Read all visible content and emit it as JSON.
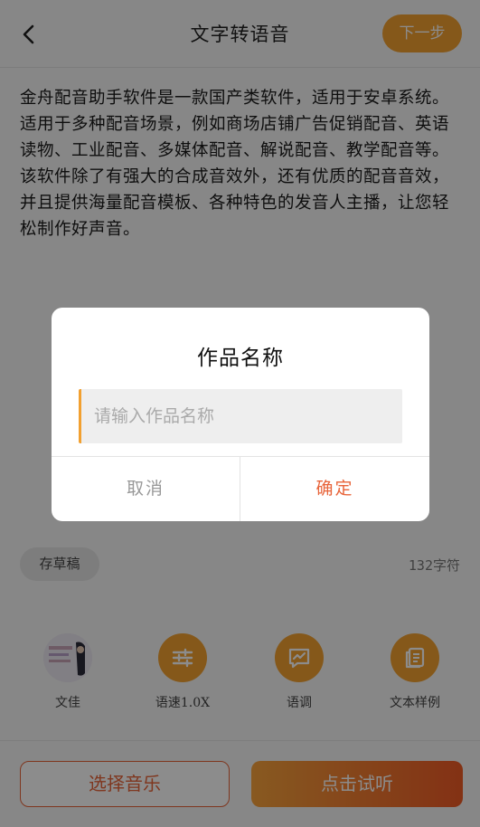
{
  "header": {
    "title": "文字转语音",
    "next_label": "下一步"
  },
  "content": {
    "text": "金舟配音助手软件是一款国产类软件，适用于安卓系统。适用于多种配音场景，例如商场店铺广告促销配音、英语读物、工业配音、多媒体配音、解说配音、教学配音等。该软件除了有强大的合成音效外，还有优质的配音音效，并且提供海量配音模板、各种特色的发音人主播，让您轻松制作好声音。"
  },
  "draft": {
    "label": "存草稿",
    "char_count": "132字符"
  },
  "tools": [
    {
      "label": "文佳",
      "icon": "speaker-avatar"
    },
    {
      "label": "语速1.0X",
      "icon": "sliders-icon"
    },
    {
      "label": "语调",
      "icon": "chart-message-icon"
    },
    {
      "label": "文本样例",
      "icon": "document-icon"
    }
  ],
  "bottom": {
    "music_label": "选择音乐",
    "listen_label": "点击试听"
  },
  "dialog": {
    "title": "作品名称",
    "placeholder": "请输入作品名称",
    "cancel_label": "取消",
    "confirm_label": "确定"
  },
  "colors": {
    "accent_orange": "#f2a030",
    "accent_red": "#e8643a",
    "overlay": "rgba(0,0,0,0.45)"
  }
}
